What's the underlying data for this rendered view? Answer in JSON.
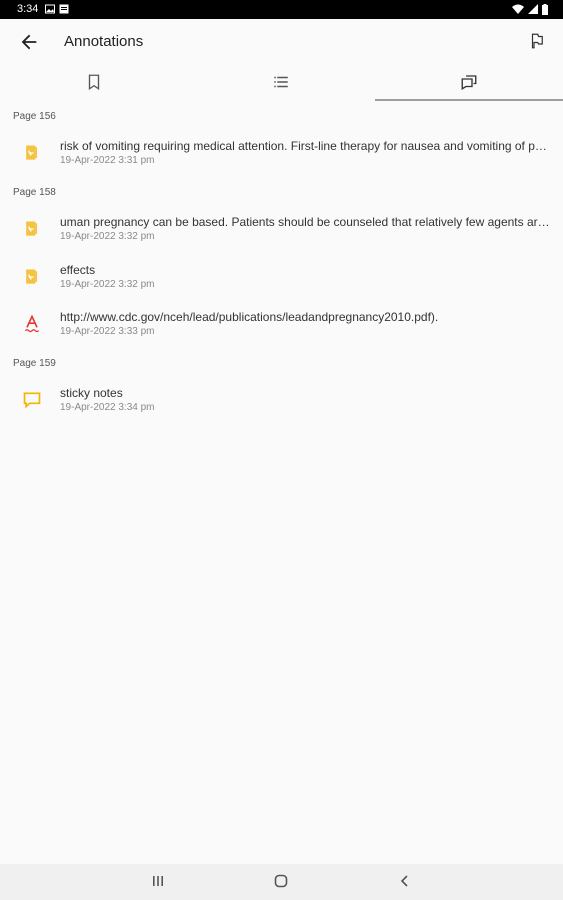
{
  "status": {
    "time": "3:34"
  },
  "appbar": {
    "title": "Annotations",
    "back_icon": "arrow-left-icon",
    "flag_icon": "flag-icon"
  },
  "tabs": [
    {
      "icon": "bookmark-icon",
      "selected": false
    },
    {
      "icon": "list-icon",
      "selected": false
    },
    {
      "icon": "comments-icon",
      "selected": true
    }
  ],
  "groups": [
    {
      "page": "Page 156",
      "items": [
        {
          "icon": "highlight-icon",
          "text": "risk of vomiting requiring medical attention. First-line therapy for nausea and vomiting of pregnancy",
          "date": "19-Apr-2022 3:31 pm"
        }
      ]
    },
    {
      "page": "Page 158",
      "items": [
        {
          "icon": "highlight-icon",
          "text": "uman pregnancy can be based. Patients should be counseled that relatively few agents are known",
          "date": "19-Apr-2022 3:32 pm"
        },
        {
          "icon": "highlight-icon",
          "text": "effects",
          "date": "19-Apr-2022 3:32 pm"
        },
        {
          "icon": "squiggly-underline-icon",
          "text": "http://www.cdc.gov/nceh/lead/publications/leadandpregnancy2010.pdf).",
          "date": "19-Apr-2022 3:33 pm"
        }
      ]
    },
    {
      "page": "Page 159",
      "items": [
        {
          "icon": "sticky-note-icon",
          "text": "sticky notes",
          "date": "19-Apr-2022 3:34 pm"
        }
      ]
    }
  ],
  "colors": {
    "highlight": "#f5c342",
    "squiggly": "#e53935",
    "note": "#f5b400"
  }
}
